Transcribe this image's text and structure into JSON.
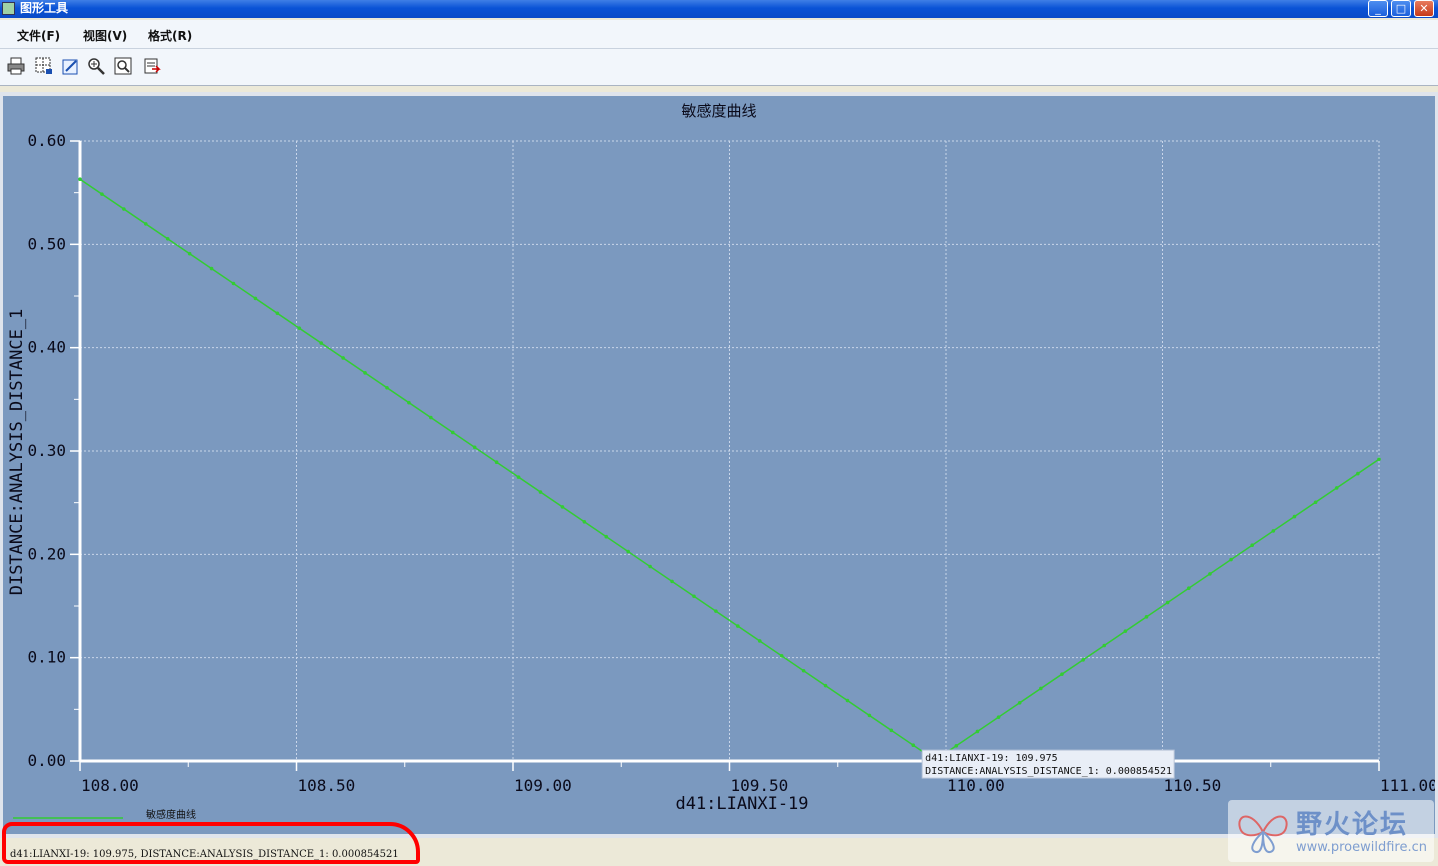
{
  "window": {
    "title": "图形工具",
    "controls": [
      "_",
      "□",
      "✕"
    ]
  },
  "menu": [
    {
      "label": "文件(F)"
    },
    {
      "label": "视图(V)"
    },
    {
      "label": "格式(R)"
    }
  ],
  "toolbar": {
    "icons": [
      "print-icon",
      "grid-icon",
      "edit-icon",
      "zoom-in-icon",
      "zoom-fit-icon",
      "export-icon"
    ]
  },
  "chart_data": {
    "type": "line",
    "title": "敏感度曲线",
    "xlabel": "d41:LIANXI-19",
    "ylabel": "DISTANCE:ANALYSIS_DISTANCE_1",
    "xlim": [
      108.0,
      111.0
    ],
    "ylim": [
      0.0,
      0.6
    ],
    "x_ticks": [
      "108.00",
      "108.50",
      "109.00",
      "109.50",
      "110.00",
      "110.50",
      "111.00"
    ],
    "y_ticks": [
      "0.00",
      "0.10",
      "0.20",
      "0.30",
      "0.40",
      "0.50",
      "0.60"
    ],
    "grid": true,
    "legend": {
      "position": "bottom-left"
    },
    "series": [
      {
        "name": "敏感度曲线",
        "color": "#33cc33",
        "points": [
          [
            108.0,
            0.563
          ],
          [
            109.975,
            0.000854521
          ],
          [
            111.0,
            0.292
          ]
        ]
      }
    ],
    "annotation": {
      "lines": [
        "d41:LIANXI-19: 109.975",
        "DISTANCE:ANALYSIS_DISTANCE_1: 0.000854521"
      ],
      "x": 109.975,
      "y": 0.000854521
    }
  },
  "status": {
    "text": "d41:LIANXI-19: 109.975, DISTANCE:ANALYSIS_DISTANCE_1: 0.000854521"
  },
  "watermark": {
    "text": "野火论坛",
    "url": "www.proewildfire.cn"
  }
}
